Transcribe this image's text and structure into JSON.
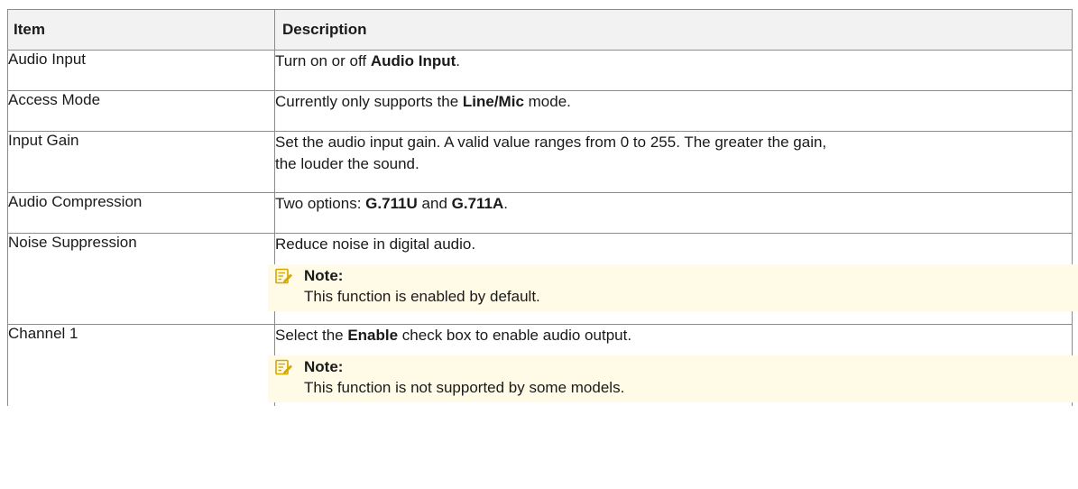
{
  "table": {
    "headers": {
      "item": "Item",
      "description": "Description"
    },
    "rows": [
      {
        "item": "Audio Input",
        "desc": [
          {
            "t": "Turn on or off "
          },
          {
            "t": "Audio Input",
            "b": true
          },
          {
            "t": "."
          }
        ]
      },
      {
        "item": "Access Mode",
        "desc": [
          {
            "t": "Currently only supports the "
          },
          {
            "t": "Line/Mic",
            "b": true
          },
          {
            "t": " mode."
          }
        ]
      },
      {
        "item": "Input Gain",
        "desc_line1": "Set the audio input gain. A valid value ranges from 0 to 255. The greater the gain,",
        "desc_line2": "the louder the sound."
      },
      {
        "item": "Audio Compression",
        "desc": [
          {
            "t": "Two options: "
          },
          {
            "t": "G.711U",
            "b": true
          },
          {
            "t": " and "
          },
          {
            "t": "G.711A",
            "b": true
          },
          {
            "t": "."
          }
        ]
      },
      {
        "item": "Noise Suppression",
        "desc_text": "Reduce noise in digital audio.",
        "note_label": "Note:",
        "note_text": "This function is enabled by default."
      },
      {
        "item": "Channel 1",
        "desc": [
          {
            "t": "Select the "
          },
          {
            "t": "Enable",
            "b": true
          },
          {
            "t": " check box to enable audio output."
          }
        ],
        "note_label": "Note:",
        "note_text": "This function is not supported by some models."
      }
    ]
  },
  "colors": {
    "header_bg": "#f2f2f2",
    "note_bg": "#fffbe6",
    "note_icon": "#d4a800",
    "border": "#8c8c8c"
  },
  "icons": {
    "note": "note-pencil-icon"
  }
}
